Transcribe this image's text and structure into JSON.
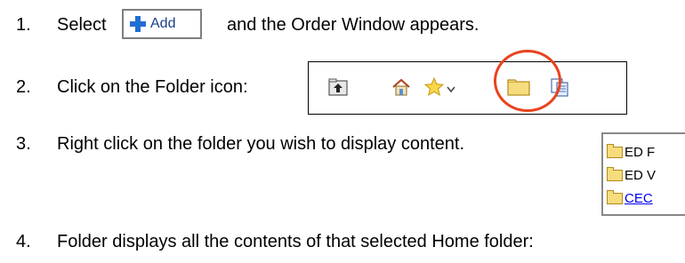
{
  "steps": [
    {
      "number": "1.",
      "text_before": "Select",
      "text_after": "and the Order Window appears."
    },
    {
      "number": "2.",
      "text": "Click on the Folder icon:"
    },
    {
      "number": "3.",
      "text": "Right click on the folder you wish to display content."
    },
    {
      "number": "4.",
      "text": "Folder displays all the contents of that selected Home folder:"
    }
  ],
  "add_button": {
    "label": "Add",
    "icon": "plus-icon",
    "accent": "#1f6fd1"
  },
  "toolbar": {
    "icons": [
      "up-folder-icon",
      "home-icon",
      "favorites-star-icon",
      "dropdown-arrow-icon",
      "folder-icon",
      "copy-icon"
    ],
    "highlight_color": "#e8431e"
  },
  "folder_tree": {
    "items": [
      {
        "label": "ED F",
        "link": false
      },
      {
        "label": "ED V",
        "link": false
      },
      {
        "label": "CEC",
        "link": true
      }
    ]
  }
}
